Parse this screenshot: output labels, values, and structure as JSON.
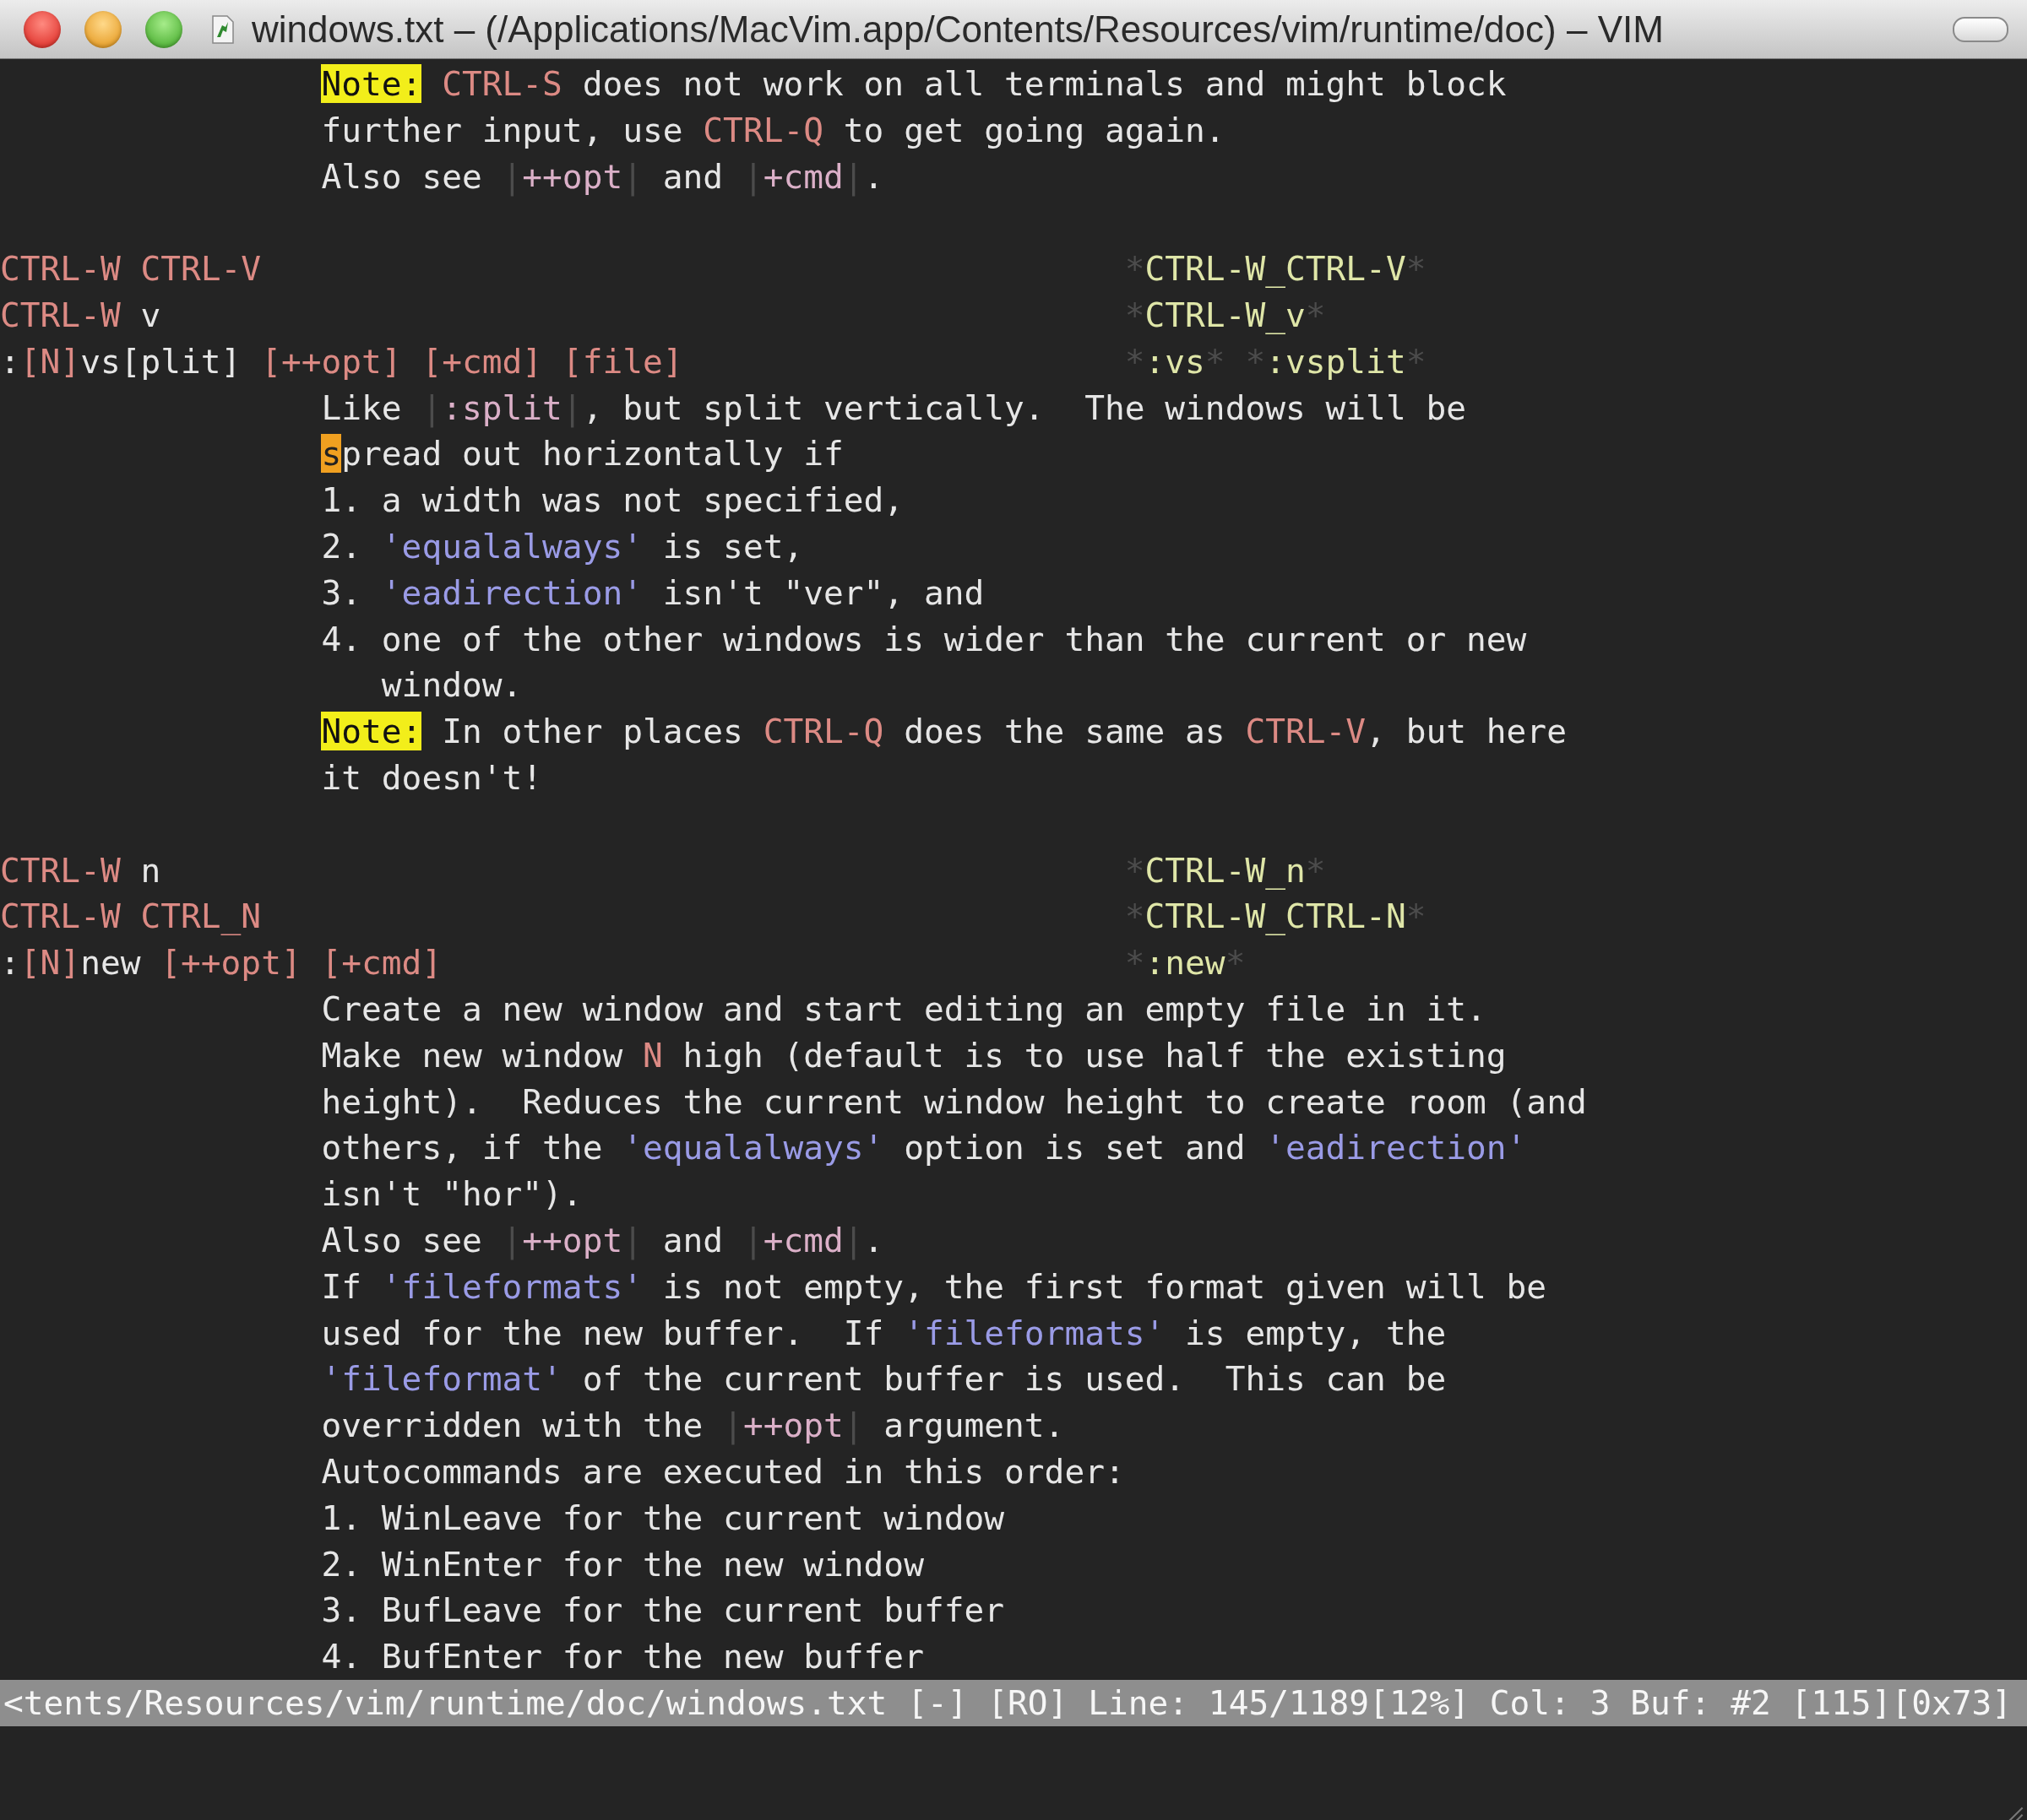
{
  "window": {
    "title": "windows.txt – (/Applications/MacVim.app/Contents/Resources/vim/runtime/doc) – VIM"
  },
  "lines": [
    {
      "kind": "body",
      "segments": [
        {
          "kind": "note",
          "text": "Note:"
        },
        {
          "kind": "key",
          "text": " CTRL-S"
        },
        {
          "kind": "text",
          "text": " does not work on all terminals and might block"
        }
      ]
    },
    {
      "kind": "body",
      "segments": [
        {
          "kind": "text",
          "text": "further input, use "
        },
        {
          "kind": "key",
          "text": "CTRL-Q"
        },
        {
          "kind": "text",
          "text": " to get going again."
        }
      ]
    },
    {
      "kind": "body",
      "segments": [
        {
          "kind": "text",
          "text": "Also see "
        },
        {
          "kind": "conceal",
          "text": "|"
        },
        {
          "kind": "link",
          "text": "++opt"
        },
        {
          "kind": "conceal",
          "text": "|"
        },
        {
          "kind": "text",
          "text": " and "
        },
        {
          "kind": "conceal",
          "text": "|"
        },
        {
          "kind": "link",
          "text": "+cmd"
        },
        {
          "kind": "conceal",
          "text": "|"
        },
        {
          "kind": "text",
          "text": "."
        }
      ]
    },
    {
      "kind": "blank"
    },
    {
      "kind": "head",
      "segments": [
        {
          "kind": "key",
          "text": "CTRL-W CTRL-V"
        }
      ],
      "tags": [
        {
          "kind": "conceal",
          "text": "*"
        },
        {
          "kind": "tag",
          "text": "CTRL-W_CTRL-V"
        },
        {
          "kind": "conceal",
          "text": "*"
        }
      ]
    },
    {
      "kind": "head",
      "segments": [
        {
          "kind": "key",
          "text": "CTRL-W"
        },
        {
          "kind": "text",
          "text": " v"
        }
      ],
      "tags": [
        {
          "kind": "conceal",
          "text": "*"
        },
        {
          "kind": "tag",
          "text": "CTRL-W_v"
        },
        {
          "kind": "conceal",
          "text": "*"
        }
      ]
    },
    {
      "kind": "head",
      "segments": [
        {
          "kind": "text",
          "text": ":"
        },
        {
          "kind": "key",
          "text": "[N]"
        },
        {
          "kind": "text",
          "text": "vs[plit]"
        },
        {
          "kind": "key",
          "text": " [++opt] [+cmd] [file]"
        }
      ],
      "tags": [
        {
          "kind": "conceal",
          "text": "*"
        },
        {
          "kind": "tag",
          "text": ":vs"
        },
        {
          "kind": "conceal",
          "text": "* *"
        },
        {
          "kind": "tag",
          "text": ":vsplit"
        },
        {
          "kind": "conceal",
          "text": "*"
        }
      ]
    },
    {
      "kind": "body",
      "segments": [
        {
          "kind": "text",
          "text": "Like "
        },
        {
          "kind": "conceal",
          "text": "|"
        },
        {
          "kind": "link",
          "text": ":split"
        },
        {
          "kind": "conceal",
          "text": "|"
        },
        {
          "kind": "text",
          "text": ", but split vertically.  The windows will be"
        }
      ]
    },
    {
      "kind": "body",
      "segments": [
        {
          "kind": "cursor",
          "text": "s"
        },
        {
          "kind": "text",
          "text": "pread out horizontally if"
        }
      ]
    },
    {
      "kind": "body",
      "segments": [
        {
          "kind": "text",
          "text": "1. a width was not specified,"
        }
      ]
    },
    {
      "kind": "body",
      "segments": [
        {
          "kind": "text",
          "text": "2. "
        },
        {
          "kind": "option",
          "text": "'equalalways'"
        },
        {
          "kind": "text",
          "text": " is set,"
        }
      ]
    },
    {
      "kind": "body",
      "segments": [
        {
          "kind": "text",
          "text": "3. "
        },
        {
          "kind": "option",
          "text": "'eadirection'"
        },
        {
          "kind": "text",
          "text": " isn't \"ver\", and"
        }
      ]
    },
    {
      "kind": "body",
      "segments": [
        {
          "kind": "text",
          "text": "4. one of the other windows is wider than the current or new"
        }
      ]
    },
    {
      "kind": "body",
      "segments": [
        {
          "kind": "text",
          "text": "   window."
        }
      ]
    },
    {
      "kind": "body",
      "segments": [
        {
          "kind": "note",
          "text": "Note:"
        },
        {
          "kind": "text",
          "text": " In other places "
        },
        {
          "kind": "key",
          "text": "CTRL-Q"
        },
        {
          "kind": "text",
          "text": " does the same as "
        },
        {
          "kind": "key",
          "text": "CTRL-V"
        },
        {
          "kind": "text",
          "text": ", but here"
        }
      ]
    },
    {
      "kind": "body",
      "segments": [
        {
          "kind": "text",
          "text": "it doesn't!"
        }
      ]
    },
    {
      "kind": "blank"
    },
    {
      "kind": "head",
      "segments": [
        {
          "kind": "key",
          "text": "CTRL-W"
        },
        {
          "kind": "text",
          "text": " n"
        }
      ],
      "tags": [
        {
          "kind": "conceal",
          "text": "*"
        },
        {
          "kind": "tag",
          "text": "CTRL-W_n"
        },
        {
          "kind": "conceal",
          "text": "*"
        }
      ]
    },
    {
      "kind": "head",
      "segments": [
        {
          "kind": "key",
          "text": "CTRL-W CTRL_N"
        }
      ],
      "tags": [
        {
          "kind": "conceal",
          "text": "*"
        },
        {
          "kind": "tag",
          "text": "CTRL-W_CTRL-N"
        },
        {
          "kind": "conceal",
          "text": "*"
        }
      ]
    },
    {
      "kind": "head",
      "segments": [
        {
          "kind": "text",
          "text": ":"
        },
        {
          "kind": "key",
          "text": "[N]"
        },
        {
          "kind": "text",
          "text": "new"
        },
        {
          "kind": "key",
          "text": " [++opt] [+cmd]"
        }
      ],
      "tags": [
        {
          "kind": "conceal",
          "text": "*"
        },
        {
          "kind": "tag",
          "text": ":new"
        },
        {
          "kind": "conceal",
          "text": "*"
        }
      ]
    },
    {
      "kind": "body",
      "segments": [
        {
          "kind": "text",
          "text": "Create a new window and start editing an empty file in it."
        }
      ]
    },
    {
      "kind": "body",
      "segments": [
        {
          "kind": "text",
          "text": "Make new window "
        },
        {
          "kind": "key",
          "text": "N"
        },
        {
          "kind": "text",
          "text": " high (default is to use half the existing"
        }
      ]
    },
    {
      "kind": "body",
      "segments": [
        {
          "kind": "text",
          "text": "height).  Reduces the current window height to create room (and"
        }
      ]
    },
    {
      "kind": "body",
      "segments": [
        {
          "kind": "text",
          "text": "others, if the "
        },
        {
          "kind": "option",
          "text": "'equalalways'"
        },
        {
          "kind": "text",
          "text": " option is set and "
        },
        {
          "kind": "option",
          "text": "'eadirection'"
        }
      ]
    },
    {
      "kind": "body",
      "segments": [
        {
          "kind": "text",
          "text": "isn't \"hor\")."
        }
      ]
    },
    {
      "kind": "body",
      "segments": [
        {
          "kind": "text",
          "text": "Also see "
        },
        {
          "kind": "conceal",
          "text": "|"
        },
        {
          "kind": "link",
          "text": "++opt"
        },
        {
          "kind": "conceal",
          "text": "|"
        },
        {
          "kind": "text",
          "text": " and "
        },
        {
          "kind": "conceal",
          "text": "|"
        },
        {
          "kind": "link",
          "text": "+cmd"
        },
        {
          "kind": "conceal",
          "text": "|"
        },
        {
          "kind": "text",
          "text": "."
        }
      ]
    },
    {
      "kind": "body",
      "segments": [
        {
          "kind": "text",
          "text": "If "
        },
        {
          "kind": "option",
          "text": "'fileformats'"
        },
        {
          "kind": "text",
          "text": " is not empty, the first format given will be"
        }
      ]
    },
    {
      "kind": "body",
      "segments": [
        {
          "kind": "text",
          "text": "used for the new buffer.  If "
        },
        {
          "kind": "option",
          "text": "'fileformats'"
        },
        {
          "kind": "text",
          "text": " is empty, the"
        }
      ]
    },
    {
      "kind": "body",
      "segments": [
        {
          "kind": "option",
          "text": "'fileformat'"
        },
        {
          "kind": "text",
          "text": " of the current buffer is used.  This can be"
        }
      ]
    },
    {
      "kind": "body",
      "segments": [
        {
          "kind": "text",
          "text": "overridden with the "
        },
        {
          "kind": "conceal",
          "text": "|"
        },
        {
          "kind": "link",
          "text": "++opt"
        },
        {
          "kind": "conceal",
          "text": "|"
        },
        {
          "kind": "text",
          "text": " argument."
        }
      ]
    },
    {
      "kind": "body",
      "segments": [
        {
          "kind": "text",
          "text": "Autocommands are executed in this order:"
        }
      ]
    },
    {
      "kind": "body",
      "segments": [
        {
          "kind": "text",
          "text": "1. WinLeave for the current window"
        }
      ]
    },
    {
      "kind": "body",
      "segments": [
        {
          "kind": "text",
          "text": "2. WinEnter for the new window"
        }
      ]
    },
    {
      "kind": "body",
      "segments": [
        {
          "kind": "text",
          "text": "3. BufLeave for the current buffer"
        }
      ]
    },
    {
      "kind": "body",
      "segments": [
        {
          "kind": "text",
          "text": "4. BufEnter for the new buffer"
        }
      ]
    }
  ],
  "status_bar": {
    "text": "<tents/Resources/vim/runtime/doc/windows.txt [-] [RO] Line: 145/1189[12%] Col: 3 Buf: #2 [115][0x73]"
  }
}
